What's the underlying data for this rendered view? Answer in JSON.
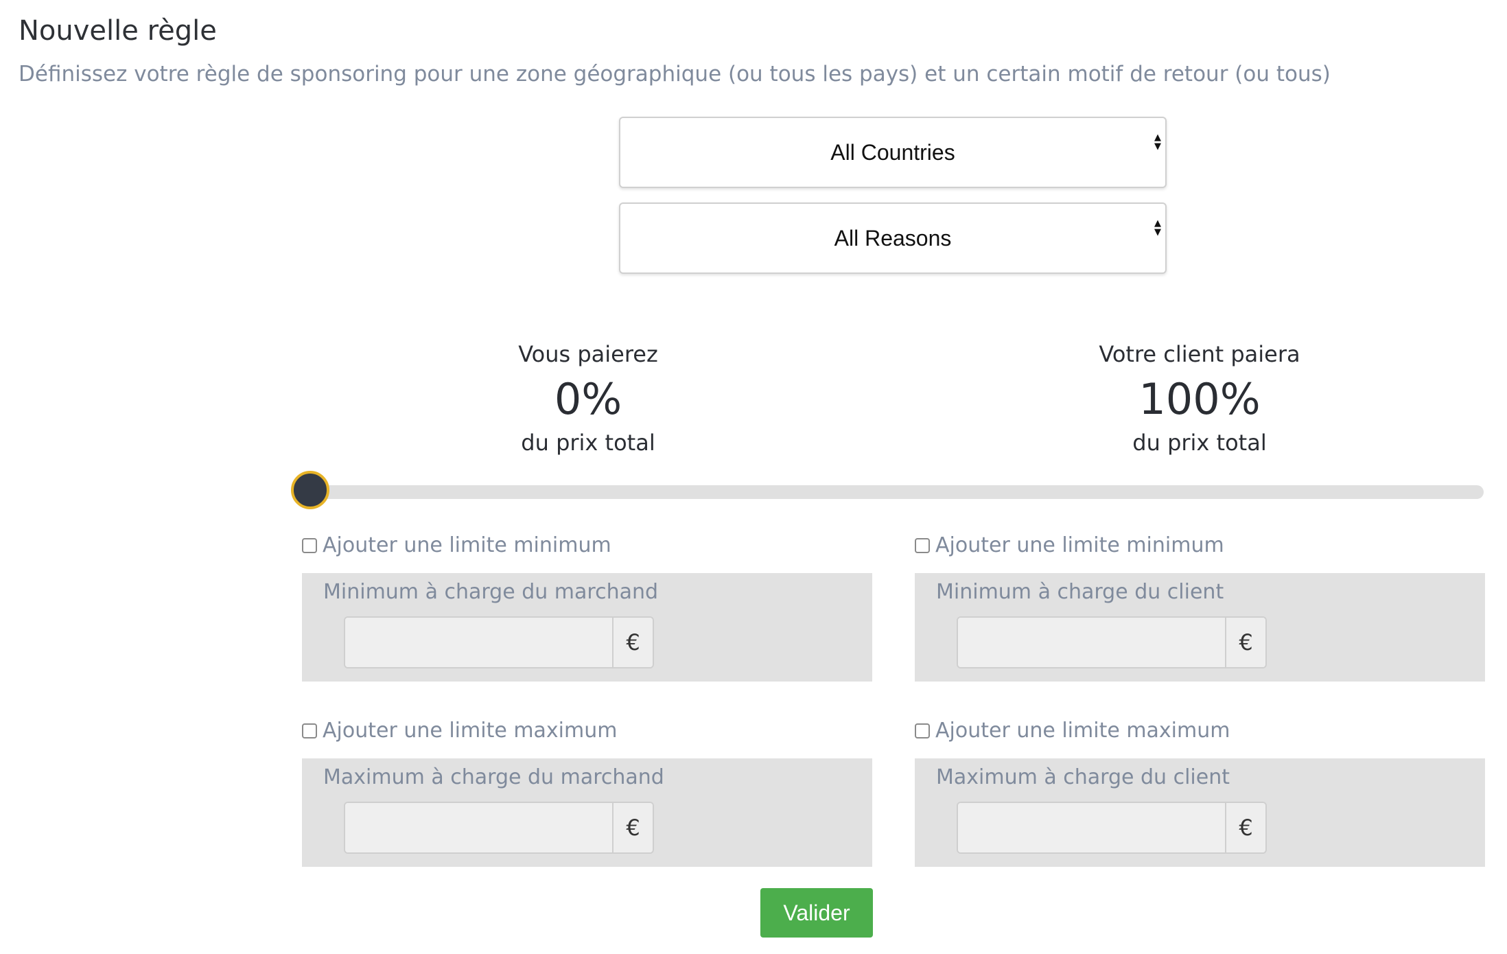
{
  "header": {
    "title": "Nouvelle règle",
    "subtitle": "Définissez votre règle de sponsoring pour une zone géographique (ou tous les pays) et un certain motif de retour (ou tous)"
  },
  "filters": {
    "country_selected": "All Countries",
    "reason_selected": "All Reasons"
  },
  "split": {
    "merchant_label": "Vous paierez",
    "merchant_percent": "0%",
    "merchant_sub": "du prix total",
    "client_label": "Votre client paiera",
    "client_percent": "100%",
    "client_sub": "du prix total",
    "slider_value_percent": 0
  },
  "merchant": {
    "min_checkbox_label": "Ajouter une limite minimum",
    "min_panel_label": "Minimum à charge du marchand",
    "max_checkbox_label": "Ajouter une limite maximum",
    "max_panel_label": "Maximum à charge du marchand",
    "currency": "€"
  },
  "client": {
    "min_checkbox_label": "Ajouter une limite minimum",
    "min_panel_label": "Minimum à charge du client",
    "max_checkbox_label": "Ajouter une limite maximum",
    "max_panel_label": "Maximum à charge du client",
    "currency": "€"
  },
  "actions": {
    "submit_label": "Valider"
  },
  "colors": {
    "submit_button": "#4cae4c",
    "slider_thumb": "#343a45",
    "slider_thumb_border": "#e7b327",
    "muted_text": "#7f8a9c"
  }
}
